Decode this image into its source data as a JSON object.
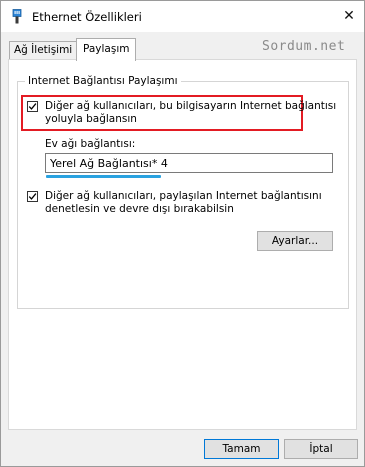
{
  "window": {
    "title": "Ethernet Özellikleri",
    "close_label": "✕"
  },
  "tabs": [
    {
      "label": "Ağ İletişimi",
      "active": false
    },
    {
      "label": "Paylaşım",
      "active": true
    }
  ],
  "watermark": "Sordum.net",
  "sharing": {
    "group_title": "Internet Bağlantısı Paylaşımı",
    "allow_connect": {
      "checked": true,
      "line1": "Diğer ağ kullanıcıları, bu bilgisayarın Internet bağlantısı",
      "line2": "yoluyla bağlansın"
    },
    "home_network_label": "Ev ağı bağlantısı:",
    "home_network_value": "Yerel Ağ Bağlantısı* 4",
    "allow_control": {
      "checked": true,
      "line1": "Diğer ağ kullanıcıları, paylaşılan Internet bağlantısını",
      "line2": "denetlesin ve devre dışı bırakabilsin"
    },
    "settings_button": "Ayarlar..."
  },
  "footer": {
    "ok_button": "Tamam",
    "cancel_button": "İptal"
  },
  "colors": {
    "highlight_border": "#e31b23",
    "combo_underline": "#2aa2e0",
    "default_button_border": "#0078d7"
  },
  "icons": {
    "title": "ethernet-cable-icon",
    "close": "close-icon",
    "check": "checkmark-icon"
  }
}
